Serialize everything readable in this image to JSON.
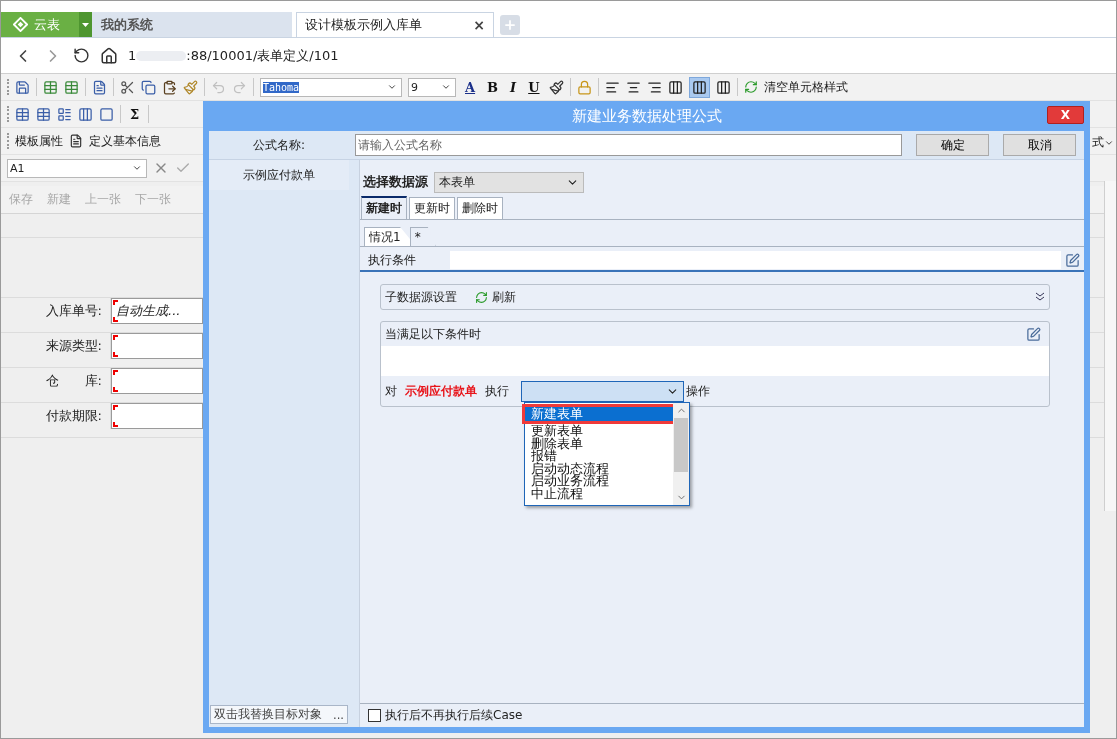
{
  "app_tabs": [
    {
      "label": "云表",
      "kind": "brand",
      "selected": false
    },
    {
      "label": "我的系统",
      "kind": "tab",
      "selected": false
    },
    {
      "label": "设计模板示例入库单",
      "kind": "tab",
      "selected": true,
      "close": "×"
    }
  ],
  "address": {
    "start": "1",
    "end": ":88/10001/表单定义/101"
  },
  "format_toolbar": {
    "font": "Tahoma",
    "size": "9",
    "font_color": "A",
    "bold": "B",
    "italic": "I",
    "underline": "U",
    "clear_style": "清空单元格样式"
  },
  "table_toolbar": {
    "sum": "Σ"
  },
  "template_toolbar": {
    "template_props": "模板属性",
    "basic_info": "定义基本信息",
    "cut_label": "式"
  },
  "cell_ref": "A1",
  "actions": [
    {
      "label": "保存",
      "disabled": true
    },
    {
      "label": "新建",
      "disabled": true
    },
    {
      "label": "上一张",
      "disabled": true
    },
    {
      "label": "下一张",
      "disabled": true
    }
  ],
  "form_fields": [
    {
      "label": "入库单号:",
      "value": "自动生成..."
    },
    {
      "label": "来源类型:"
    },
    {
      "label": "仓　　库:"
    },
    {
      "label": "付款期限:"
    }
  ],
  "dialog": {
    "title": "新建业务数据处理公式",
    "close": "X",
    "name_label": "公式名称:",
    "name_placeholder": "请输入公式名称",
    "ok": "确定",
    "cancel": "取消",
    "targets": [
      "示例应付款单"
    ],
    "replace_field": "双击我替换目标对象",
    "replace_button": "...",
    "datasource_label": "选择数据源",
    "datasource_value": "本表单",
    "event_tabs": [
      {
        "label": "新建时",
        "selected": true
      },
      {
        "label": "更新时",
        "selected": false
      },
      {
        "label": "删除时",
        "selected": false
      }
    ],
    "case_tabs": [
      {
        "label": "情况1",
        "selected": true
      },
      {
        "label": "*",
        "selected": false
      }
    ],
    "condition_label": "执行条件",
    "sub_source": {
      "label": "子数据源设置",
      "refresh": "刷新"
    },
    "when_label": "当满足以下条件时",
    "action_row": {
      "prefix": "对",
      "target": "示例应付款单",
      "verb": "执行",
      "suffix": "操作"
    },
    "operation_options": [
      {
        "label": "新建表单",
        "selected": true
      },
      {
        "label": "更新表单",
        "selected": false
      },
      {
        "label": "删除表单",
        "selected": false
      },
      {
        "label": "报错",
        "selected": false
      },
      {
        "label": "启动动态流程",
        "selected": false
      },
      {
        "label": "启动业务流程",
        "selected": false
      },
      {
        "label": "中止流程",
        "selected": false
      }
    ],
    "footer_checkbox": {
      "label": "执行后不再执行后续Case",
      "checked": false
    }
  }
}
